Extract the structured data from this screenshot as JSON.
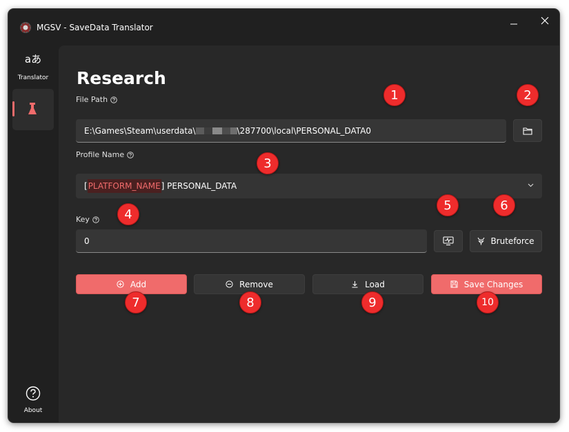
{
  "window": {
    "title": "MGSV - SaveData Translator"
  },
  "sidebar": {
    "translator": {
      "glyph": "aあ",
      "label": "Translator"
    },
    "research": {
      "icon": "flask-icon",
      "selected": true
    },
    "about": {
      "label": "About"
    }
  },
  "page": {
    "title": "Research"
  },
  "file_path": {
    "label": "File Path",
    "value_prefix": "E:\\Games\\Steam\\userdata\\",
    "value_suffix": "\\287700\\local\\PERSONAL_DATA0",
    "redacted": true
  },
  "profile_name": {
    "label": "Profile Name",
    "open_bracket": "[",
    "platform_tag": "PLATFORM_NAME",
    "value_rest": "] PERSONAL_DATA"
  },
  "key": {
    "label": "Key",
    "value": "0",
    "bruteforce_label": "Bruteforce"
  },
  "actions": {
    "add_label": "Add",
    "remove_label": "Remove",
    "load_label": "Load",
    "save_label": "Save Changes"
  },
  "callouts": [
    "1",
    "2",
    "3",
    "4",
    "5",
    "6",
    "7",
    "8",
    "9",
    "10"
  ],
  "colors": {
    "accent": "#f06b6b",
    "callout": "#ee2c2c",
    "tag_background": "#4a2020"
  }
}
